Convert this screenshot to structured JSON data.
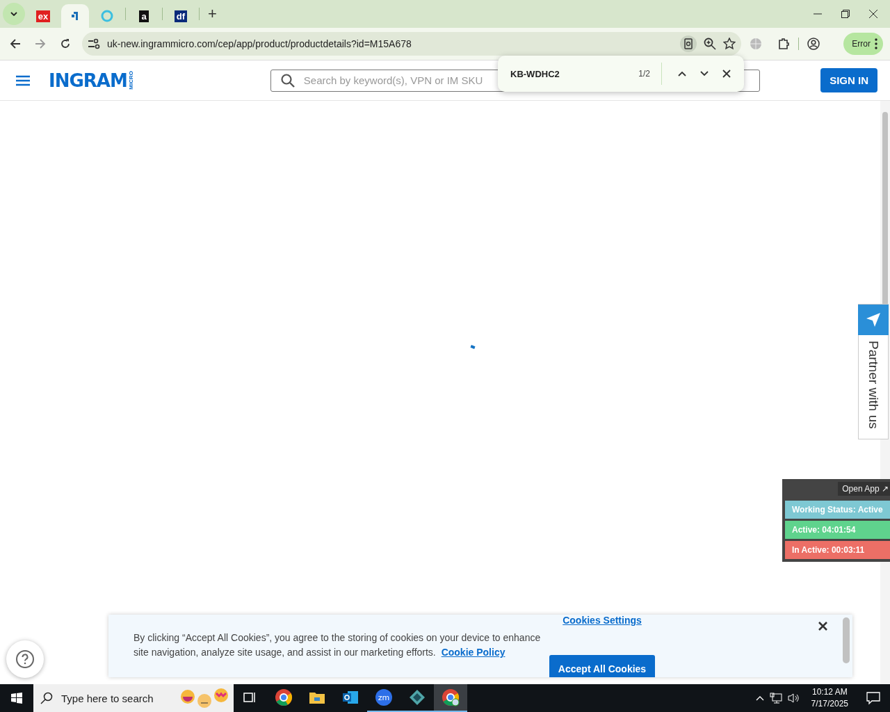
{
  "browser": {
    "tabs": [
      {
        "kind": "text",
        "glyph": "ex",
        "selected": false
      },
      {
        "kind": "hook",
        "selected": true
      },
      {
        "kind": "ring",
        "selected": false
      },
      {
        "kind": "text",
        "glyph": "a",
        "selected": false
      },
      {
        "kind": "text",
        "glyph": "df",
        "selected": false
      }
    ],
    "new_tab": "+",
    "url": "uk-new.ingrammicro.com/cep/app/product/productdetails?id=M15A678",
    "profile_status": "Error",
    "find_bar": {
      "query": "KB-WDHC2",
      "count": "1/2"
    }
  },
  "header": {
    "logo": {
      "name": "INGRAM",
      "sub": "MICRO"
    },
    "search": {
      "placeholder": "Search by keyword(s), VPN or IM SKU"
    },
    "sign_in": "SIGN IN"
  },
  "partner_tab": "Partner with us",
  "tracker": {
    "open_app": "Open App ↗",
    "rows": [
      {
        "text": "Working Status: Active",
        "color": "#7ec8d3"
      },
      {
        "text": "Active: 04:01:54",
        "color": "#5fd38d"
      },
      {
        "text": "In Active: 00:03:11",
        "color": "#ec6f66"
      }
    ]
  },
  "cookie_banner": {
    "settings_link": "Cookies Settings",
    "message": "By clicking “Accept All Cookies”, you agree to the storing of cookies on your device to enhance site navigation, analyze site usage, and assist in our marketing efforts.",
    "policy_link": "Cookie Policy",
    "accept": "Accept All Cookies"
  },
  "taskbar": {
    "search_placeholder": "Type here to search",
    "apps": [
      {
        "kind": "taskview",
        "running": false,
        "selected": false
      },
      {
        "kind": "chrome",
        "running": false,
        "selected": false
      },
      {
        "kind": "files",
        "running": false,
        "selected": false
      },
      {
        "kind": "outlook",
        "running": false,
        "selected": false
      },
      {
        "kind": "zoom",
        "glyph": "zm",
        "running": true,
        "selected": false
      },
      {
        "kind": "diamond",
        "running": true,
        "selected": false
      },
      {
        "kind": "chrome-profile",
        "running": true,
        "selected": true
      }
    ],
    "time": "10:12 AM",
    "date": "7/17/2025"
  }
}
